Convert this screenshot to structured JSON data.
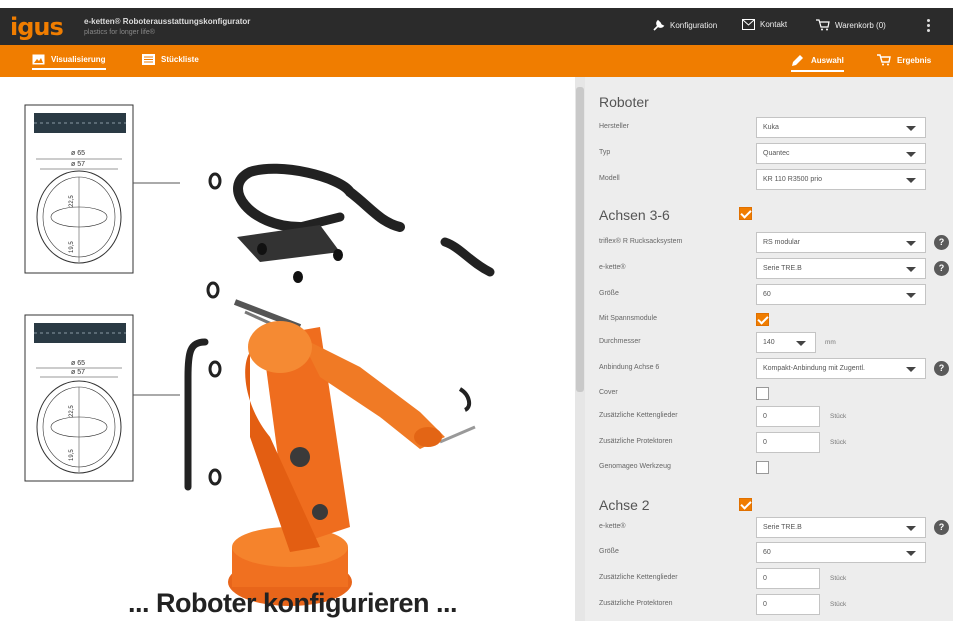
{
  "header": {
    "logo": "igus",
    "app_title": "e-ketten® Roboterausstattungskonfigurator",
    "app_subtitle": "plastics for longer life®",
    "konfiguration": "Konfiguration",
    "kontakt": "Kontakt",
    "warenkorb": "Warenkorb (0)"
  },
  "tabs": {
    "visualisierung": "Visualisierung",
    "stueckliste": "Stückliste",
    "auswahl": "Auswahl",
    "ergebnis": "Ergebnis"
  },
  "drawings": {
    "d1_outer": "ø 65",
    "d1_inner": "ø 57",
    "d1_dim_a": "22,5",
    "d1_dim_b": "19,5",
    "d2_outer": "ø 65",
    "d2_inner": "ø 57",
    "d2_dim_a": "22,5",
    "d2_dim_b": "19,5"
  },
  "caption": "... Roboter konfigurieren ...",
  "roboter": {
    "title": "Roboter",
    "hersteller_label": "Hersteller",
    "hersteller_value": "Kuka",
    "typ_label": "Typ",
    "typ_value": "Quantec",
    "modell_label": "Modell",
    "modell_value": "KR 110 R3500 prio"
  },
  "achsen36": {
    "title": "Achsen 3-6",
    "checked": true,
    "rs_label": "triflex® R Rucksacksystem",
    "rs_value": "RS modular",
    "kette_label": "e-kette®",
    "kette_value": "Serie TRE.B",
    "groesse_label": "Größe",
    "groesse_value": "60",
    "spann_label": "Mit Spannsmodule",
    "spann_checked": true,
    "durchmesser_label": "Durchmesser",
    "durchmesser_value": "140",
    "durchmesser_unit": "mm",
    "anbindung_label": "Anbindung Achse 6",
    "anbindung_value": "Kompakt-Anbindung mit Zugentl.",
    "cover_label": "Cover",
    "cover_checked": false,
    "zus_ketten_label": "Zusätzliche Kettenglieder",
    "zus_ketten_value": "0",
    "zus_ketten_unit": "Stück",
    "zus_protekt_label": "Zusätzliche Protektoren",
    "zus_protekt_value": "0",
    "zus_protekt_unit": "Stück",
    "gen_label": "Genomageo Werkzeug",
    "gen_checked": false
  },
  "achse2": {
    "title": "Achse 2",
    "checked": true,
    "kette_label": "e-kette®",
    "kette_value": "Serie TRE.B",
    "groesse_label": "Größe",
    "groesse_value": "60",
    "zus_ketten_label": "Zusätzliche Kettenglieder",
    "zus_ketten_value": "0",
    "zus_ketten_unit": "Stück",
    "zus_protekt_label": "Zusätzliche Protektoren",
    "zus_protekt_value": "0",
    "zus_protekt_unit": "Stück"
  },
  "colors": {
    "accent": "#f07d00",
    "header": "#2b2b2b",
    "panel": "#ededed"
  }
}
